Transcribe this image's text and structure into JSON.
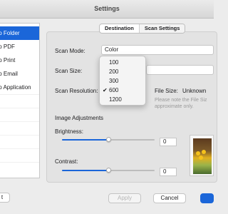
{
  "window": {
    "title": "Settings"
  },
  "sidebar": {
    "items": [
      {
        "label": "to Folder",
        "selected": true
      },
      {
        "label": "to PDF",
        "selected": false
      },
      {
        "label": "to Print",
        "selected": false
      },
      {
        "label": "to Email",
        "selected": false
      },
      {
        "label": "to Application",
        "selected": false
      }
    ]
  },
  "tabs": [
    {
      "label": "Destination",
      "active": false
    },
    {
      "label": "Scan Settings",
      "active": true
    }
  ],
  "form": {
    "scan_mode_label": "Scan Mode:",
    "scan_mode_value": "Color",
    "scan_size_label": "Scan Size:",
    "scan_resolution_label": "Scan Resolution:",
    "file_size_label": "File Size:",
    "file_size_value": "Unknown",
    "file_size_note_line1": "Please note the File Siz",
    "file_size_note_line2": "approximate only."
  },
  "resolution_menu": {
    "options": [
      "100",
      "200",
      "300",
      "600",
      "1200"
    ],
    "selected": "600"
  },
  "image_adjustments": {
    "heading": "Image Adjustments",
    "brightness_label": "Brightness:",
    "brightness_value": "0",
    "brightness_level": 0.5,
    "contrast_label": "Contrast:",
    "contrast_value": "0",
    "contrast_level": 0.5
  },
  "buttons": {
    "left_partial": "t",
    "apply": "Apply",
    "cancel": "Cancel"
  },
  "colors": {
    "accent": "#1b66d9"
  }
}
